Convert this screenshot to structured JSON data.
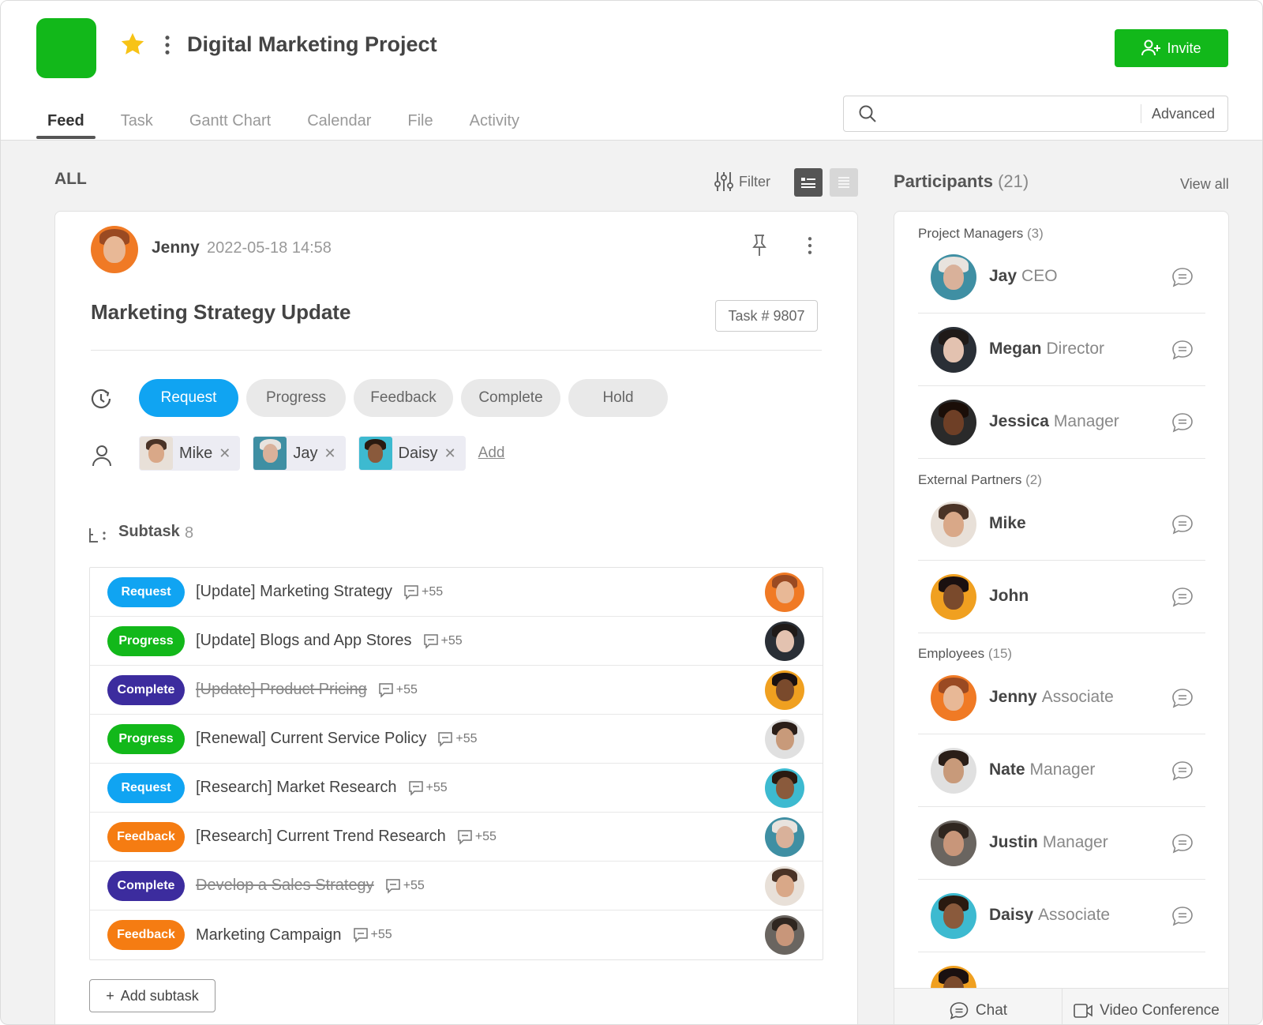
{
  "header": {
    "title": "Digital Marketing Project",
    "invite_label": "Invite",
    "tabs": [
      "Feed",
      "Task",
      "Gantt Chart",
      "Calendar",
      "File",
      "Activity"
    ],
    "active_tab": "Feed",
    "search": {
      "placeholder": "",
      "advanced_label": "Advanced"
    }
  },
  "feed": {
    "section_label": "ALL",
    "filter_label": "Filter",
    "post": {
      "author": "Jenny",
      "date": "2022-05-18 14:58",
      "title": "Marketing Strategy Update",
      "task_id": "Task # 9807",
      "statuses": [
        "Request",
        "Progress",
        "Feedback",
        "Complete",
        "Hold"
      ],
      "active_status": "Request",
      "assignees": [
        {
          "name": "Mike",
          "skin": "#d9a888",
          "hair": "#4a3326",
          "bg": "#e8e0d8"
        },
        {
          "name": "Jay",
          "skin": "#d9b19a",
          "hair": "#e8e3de",
          "bg": "#3f8fa3"
        },
        {
          "name": "Daisy",
          "skin": "#8a5a3c",
          "hair": "#2a1a10",
          "bg": "#3dbad0"
        }
      ],
      "add_label": "Add",
      "subtask_label": "Subtask",
      "subtask_count": "8",
      "subtasks": [
        {
          "status": "Request",
          "color": "#10a4f2",
          "title": "[Update] Marketing Strategy",
          "comments": "+55",
          "done": false,
          "skin": "#e8b896",
          "hair": "#9a4a22",
          "bg": "#f07a25"
        },
        {
          "status": "Progress",
          "color": "#12b81a",
          "title": "[Update] Blogs and App Stores",
          "comments": "+55",
          "done": false,
          "skin": "#e3c2b0",
          "hair": "#1f1a18",
          "bg": "#2a2f36"
        },
        {
          "status": "Complete",
          "color": "#3c2c9e",
          "title": "[Update] Product Pricing",
          "comments": "+55",
          "done": true,
          "skin": "#7a4a2c",
          "hair": "#1a1010",
          "bg": "#f0a020"
        },
        {
          "status": "Progress",
          "color": "#12b81a",
          "title": "[Renewal] Current Service Policy",
          "comments": "+55",
          "done": false,
          "skin": "#c89a7a",
          "hair": "#2a1e18",
          "bg": "#e0e0e0"
        },
        {
          "status": "Request",
          "color": "#10a4f2",
          "title": "[Research] Market Research",
          "comments": "+55",
          "done": false,
          "skin": "#8a5a3c",
          "hair": "#2a1a10",
          "bg": "#3dbad0"
        },
        {
          "status": "Feedback",
          "color": "#f57c12",
          "title": "[Research] Current Trend Research",
          "comments": "+55",
          "done": false,
          "skin": "#d9b19a",
          "hair": "#e8e3de",
          "bg": "#3f8fa3"
        },
        {
          "status": "Complete",
          "color": "#3c2c9e",
          "title": "Develop a Sales Strategy",
          "comments": "+55",
          "done": true,
          "skin": "#d9a888",
          "hair": "#4a3326",
          "bg": "#e8e0d8"
        },
        {
          "status": "Feedback",
          "color": "#f57c12",
          "title": "Marketing Campaign",
          "comments": "+55",
          "done": false,
          "skin": "#c8967a",
          "hair": "#2f2620",
          "bg": "#6a6560"
        }
      ],
      "add_subtask_label": "Add subtask"
    }
  },
  "participants": {
    "title": "Participants",
    "count": "(21)",
    "view_all_label": "View all",
    "groups": [
      {
        "label": "Project Managers",
        "count": "(3)",
        "members": [
          {
            "name": "Jay",
            "role": "CEO",
            "skin": "#d9b19a",
            "hair": "#e8e3de",
            "bg": "#3f8fa3"
          },
          {
            "name": "Megan",
            "role": "Director",
            "skin": "#e3c2b0",
            "hair": "#1f1a18",
            "bg": "#2a2f36"
          },
          {
            "name": "Jessica",
            "role": "Manager",
            "skin": "#6e3f26",
            "hair": "#1a0e08",
            "bg": "#2a2a2a"
          }
        ]
      },
      {
        "label": "External Partners",
        "count": "(2)",
        "members": [
          {
            "name": "Mike",
            "role": "",
            "skin": "#d9a888",
            "hair": "#4a3326",
            "bg": "#e8e0d8"
          },
          {
            "name": "John",
            "role": "",
            "skin": "#7a4a2c",
            "hair": "#1a1010",
            "bg": "#f0a020"
          }
        ]
      },
      {
        "label": "Employees",
        "count": "(15)",
        "members": [
          {
            "name": "Jenny",
            "role": "Associate",
            "skin": "#e8b896",
            "hair": "#9a4a22",
            "bg": "#f07a25"
          },
          {
            "name": "Nate",
            "role": "Manager",
            "skin": "#c89a7a",
            "hair": "#2a1e18",
            "bg": "#e0e0e0"
          },
          {
            "name": "Justin",
            "role": "Manager",
            "skin": "#c8967a",
            "hair": "#2f2620",
            "bg": "#6a6560"
          },
          {
            "name": "Daisy",
            "role": "Associate",
            "skin": "#8a5a3c",
            "hair": "#2a1a10",
            "bg": "#3dbad0"
          }
        ]
      }
    ],
    "chat_label": "Chat",
    "video_label": "Video Conference"
  }
}
